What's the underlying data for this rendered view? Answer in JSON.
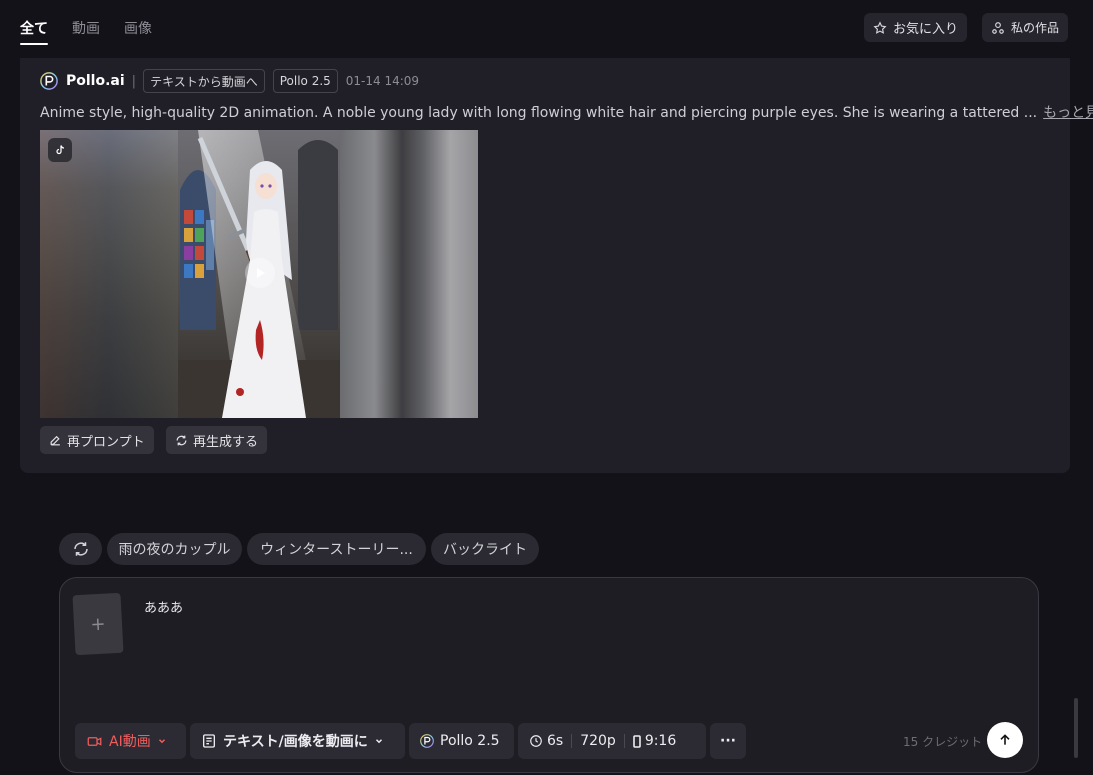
{
  "tabs": [
    {
      "label": "全て",
      "active": true
    },
    {
      "label": "動画",
      "active": false
    },
    {
      "label": "画像",
      "active": false
    }
  ],
  "header_actions": {
    "favorites_label": "お気に入り",
    "my_works_label": "私の作品"
  },
  "card": {
    "brand": "Pollo.ai",
    "mode_chip": "テキストから動画へ",
    "model_chip": "Pollo 2.5",
    "date": "01-14 14:09",
    "prompt": "Anime style, high-quality 2D animation. A noble young lady with long flowing white hair and piercing purple eyes. She is wearing a tattered ...",
    "more_label": "もっと見る",
    "reprompt_label": "再プロンプト",
    "regenerate_label": "再生成する"
  },
  "suggestions": [
    "雨の夜のカップル",
    "ウィンターストーリー...",
    "バックライト"
  ],
  "composer": {
    "input_value": "あああ",
    "upload_plus": "+",
    "type_label": "AI動画",
    "mode_label": "テキスト/画像を動画に",
    "model_label": "Pollo 2.5",
    "duration": "6s",
    "resolution": "720p",
    "aspect": "9:16",
    "more": "···",
    "credits": "15 クレジット"
  },
  "colors": {
    "background": "#131218",
    "card": "#201f27",
    "accent_ai": "#f25c5c"
  }
}
